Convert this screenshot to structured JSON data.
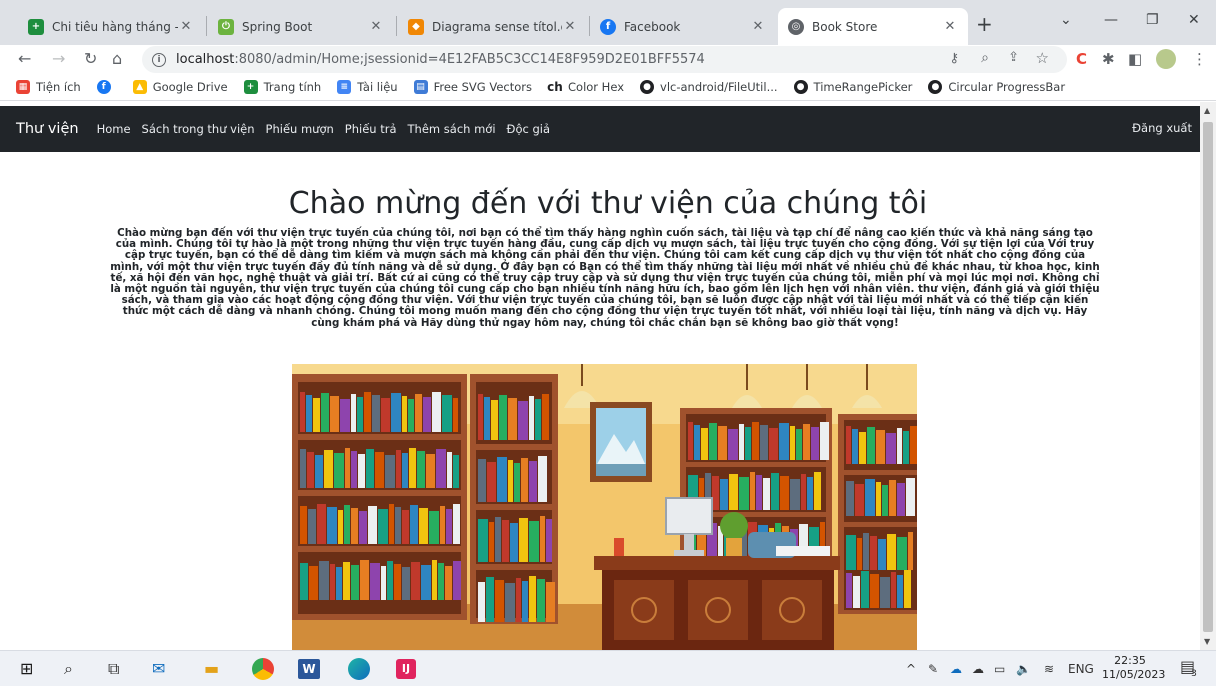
{
  "tabs": [
    {
      "title": "Chi tiêu hàng tháng - Goo",
      "icon": "sheets-icon",
      "color": "#1e8e3e"
    },
    {
      "title": "Spring Boot",
      "icon": "spring-icon",
      "color": "#6cb33f"
    },
    {
      "title": "Diagrama sense títol.draw",
      "icon": "drawio-icon",
      "color": "#f08705"
    },
    {
      "title": "Facebook",
      "icon": "facebook-icon",
      "color": "#1877f2"
    },
    {
      "title": "Book Store",
      "icon": "globe-icon",
      "color": "#5f6368"
    }
  ],
  "address": {
    "host": "localhost",
    "path": ":8080/admin/Home;jsessionid=4E12FAB5C3CC14E8F959D2E01BFF5574"
  },
  "bookmarks": [
    {
      "label": "Tiện ích",
      "icon": "apps-icon",
      "color": "#ea4335"
    },
    {
      "label": "",
      "icon": "facebook-icon",
      "color": "#1877f2"
    },
    {
      "label": "Google Drive",
      "icon": "drive-icon",
      "color": "#fbbc04"
    },
    {
      "label": "Trang tính",
      "icon": "sheets-icon",
      "color": "#1e8e3e"
    },
    {
      "label": "Tài liệu",
      "icon": "docs-icon",
      "color": "#4285f4"
    },
    {
      "label": "Free SVG Vectors",
      "icon": "svg-icon",
      "color": "#3f7bd6"
    },
    {
      "label": "Color Hex",
      "icon": "colorhex-icon",
      "color": "#202124"
    },
    {
      "label": "vlc-android/FileUtil...",
      "icon": "github-icon",
      "color": "#202124"
    },
    {
      "label": "TimeRangePicker",
      "icon": "github-icon",
      "color": "#202124"
    },
    {
      "label": "Circular ProgressBar",
      "icon": "github-icon",
      "color": "#202124"
    }
  ],
  "navbar": {
    "brand": "Thư viện",
    "links": [
      "Home",
      "Sách trong thư viện",
      "Phiếu mượn",
      "Phiếu trả",
      "Thêm sách mới",
      "Độc giả"
    ],
    "logout": "Đăng xuất"
  },
  "hero": {
    "title": "Chào mừng đến với thư viện của chúng tôi",
    "text": "Chào mừng bạn đến với thư viện trực tuyến của chúng tôi, nơi bạn có thể tìm thấy hàng nghìn cuốn sách, tài liệu và tạp chí để nâng cao kiến thức và khả năng sáng tạo của mình. Chúng tôi tự hào là một trong những thư viện trực tuyến hàng đầu, cung cấp dịch vụ mượn sách, tài liệu trực tuyến cho cộng đồng. Với sự tiện lợi của Với truy cập trực tuyến, bạn có thể dễ dàng tìm kiếm và mượn sách mà không cần phải đến thư viện. Chúng tôi cam kết cung cấp dịch vụ thư viện tốt nhất cho cộng đồng của mình, với một thư viện trực tuyến đầy đủ tính năng và dễ sử dụng. Ở đây bạn có Bạn có thể tìm thấy những tài liệu mới nhất về nhiều chủ đề khác nhau, từ khoa học, kinh tế, xã hội đến văn học, nghệ thuật và giải trí. Bất cứ ai cũng có thể truy cập truy cập và sử dụng thư viện trực tuyến của chúng tôi, miễn phí và mọi lúc mọi nơi. Không chỉ là một nguồn tài nguyên, thư viện trực tuyến của chúng tôi cung cấp cho bạn nhiều tính năng hữu ích, bao gồm lên lịch hẹn với nhân viên. thư viện, đánh giá và giới thiệu sách, và tham gia vào các hoạt động cộng đồng thư viện. Với thư viện trực tuyến của chúng tôi, bạn sẽ luôn được cập nhật với tài liệu mới nhất và có thể tiếp cận kiến thức một cách dễ dàng và nhanh chóng. Chúng tôi mong muốn mang đến cho cộng đồng thư viện trực tuyến tốt nhất, với nhiều loại tài liệu, tính năng và dịch vụ. Hãy cùng khám phá và Hãy dùng thử ngay hôm nay, chúng tôi chắc chắn bạn sẽ không bao giờ thất vọng!"
  },
  "taskbar": {
    "language": "ENG",
    "time": "22:35",
    "date": "11/05/2023",
    "notifications": "3"
  }
}
